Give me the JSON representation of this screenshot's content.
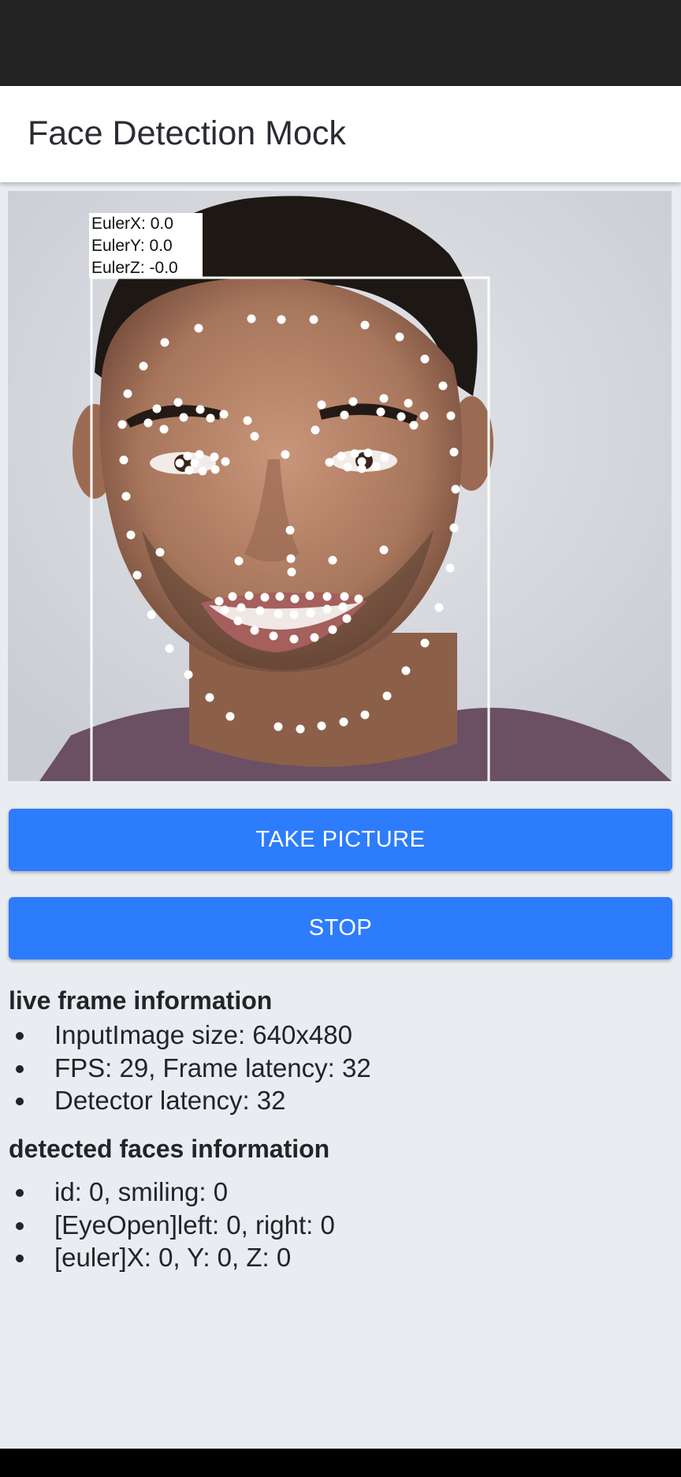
{
  "app": {
    "title": "Face Detection Mock"
  },
  "overlay": {
    "euler_x": "EulerX: 0.0",
    "euler_y": "EulerY: 0.0",
    "euler_z": "EulerZ: -0.0"
  },
  "buttons": {
    "take_picture": "TAKE PICTURE",
    "stop": "STOP"
  },
  "live_frame": {
    "title": "live frame information",
    "items": [
      "InputImage size: 640x480",
      "FPS: 29, Frame latency: 32",
      "Detector latency: 32"
    ]
  },
  "detected_faces": {
    "title": "detected faces information",
    "items": [
      "id: 0, smiling: 0",
      "[EyeOpen]left: 0, right: 0",
      "[euler]X: 0, Y: 0, Z: 0"
    ]
  },
  "colors": {
    "button": "#2d7cfc",
    "status_bar": "#232323",
    "background": "#e9ecf0"
  }
}
